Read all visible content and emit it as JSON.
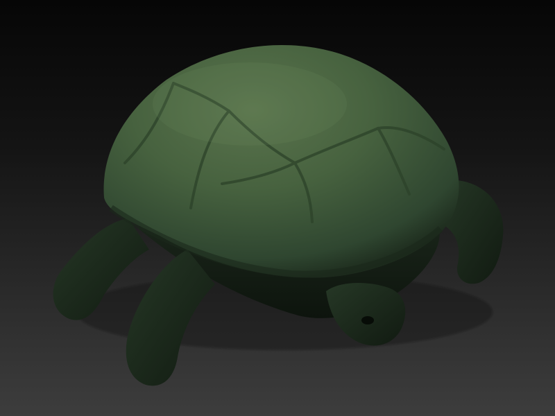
{
  "scene": {
    "subject": "turtle-sculpt",
    "colors": {
      "background_top": "#060606",
      "background_bottom": "#3d3d3d",
      "shell_light": "#556f4a",
      "shell_mid": "#3f5a38",
      "shell_dark": "#1f3020",
      "body": "#1e2c1e",
      "body_shadow": "#0f170f"
    }
  }
}
